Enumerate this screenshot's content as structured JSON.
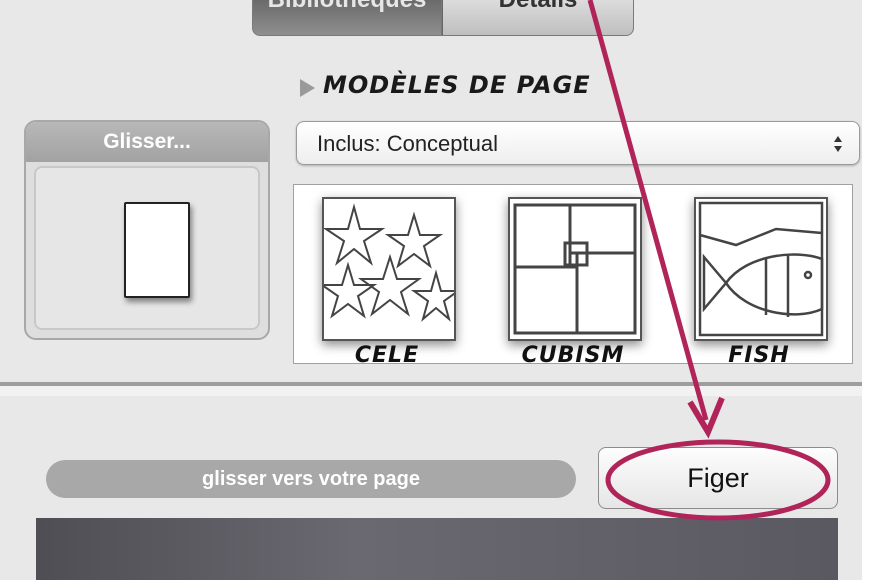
{
  "tabs": [
    {
      "label": "Bibliothèques"
    },
    {
      "label": "Détails"
    }
  ],
  "section": {
    "title": "MODÈLES DE PAGE"
  },
  "drag_well": {
    "header": "Glisser..."
  },
  "popup": {
    "selected": "Inclus: Conceptual"
  },
  "templates": [
    {
      "label": "CELE",
      "icon": "stars-template-icon"
    },
    {
      "label": "CUBISM",
      "icon": "cubism-template-icon"
    },
    {
      "label": "FISH",
      "icon": "fish-template-icon"
    }
  ],
  "drop_hint": "glisser vers votre page",
  "freeze_button": "Figer",
  "colors": {
    "annotation": "#b0245a",
    "panel": "#e8e8e8"
  }
}
